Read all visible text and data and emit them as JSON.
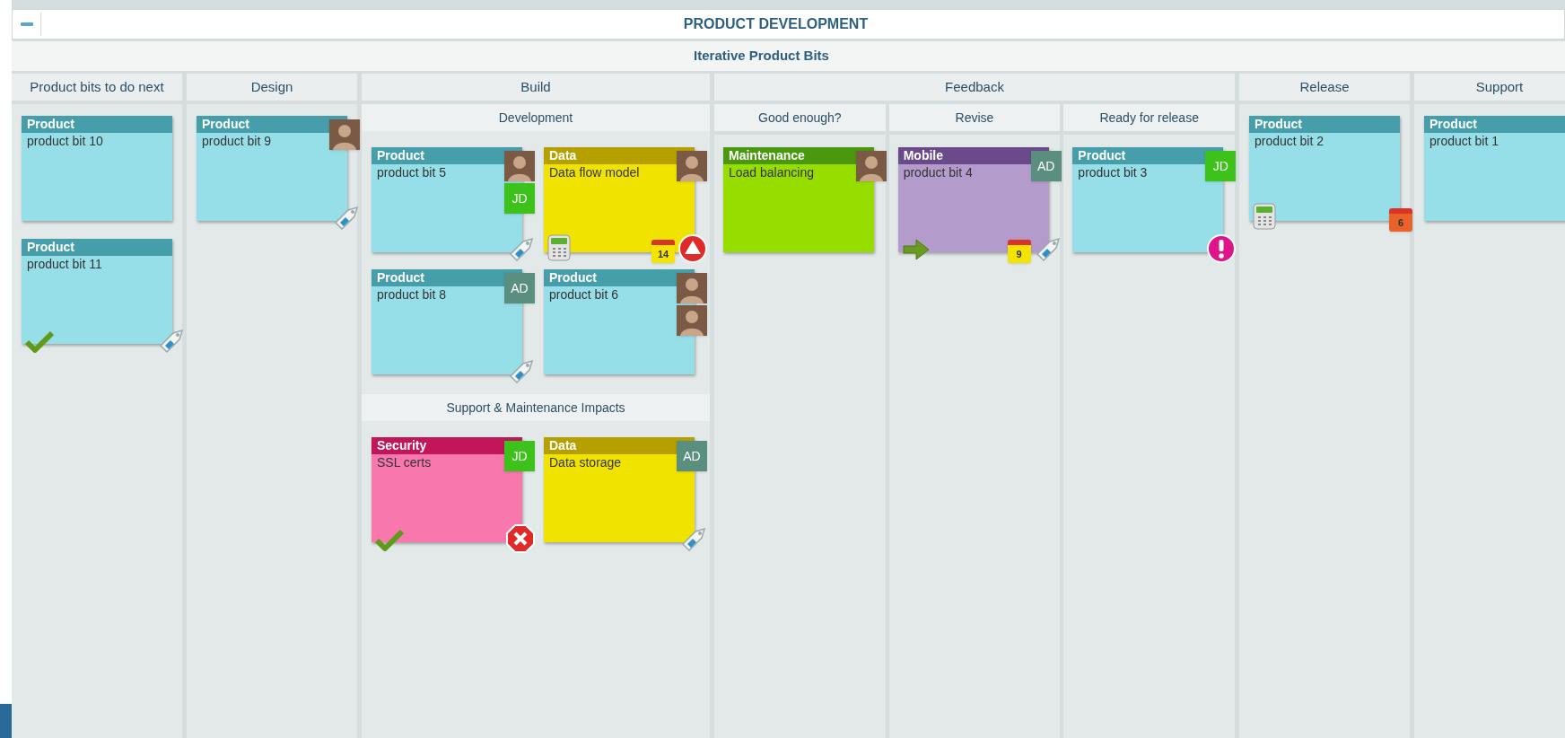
{
  "board": {
    "title": "PRODUCT DEVELOPMENT",
    "subtitle": "Iterative Product Bits"
  },
  "columns": [
    {
      "title": "Product bits to do next",
      "cards": [
        {
          "kind": "product",
          "category": "Product",
          "title": "product bit 10"
        },
        {
          "kind": "product",
          "category": "Product",
          "title": "product bit 11",
          "left_icons": [
            {
              "kind": "check"
            }
          ],
          "right_icons": [
            {
              "kind": "tag"
            }
          ]
        }
      ]
    },
    {
      "title": "Design",
      "cards": [
        {
          "kind": "product",
          "category": "Product",
          "title": "product bit 9",
          "avatars": [
            {
              "kind": "photo"
            }
          ],
          "right_icons": [
            {
              "kind": "tag"
            }
          ]
        }
      ]
    },
    {
      "title": "Build",
      "sections": [
        {
          "title": "Development",
          "cards": [
            {
              "kind": "product",
              "category": "Product",
              "title": "product bit 5",
              "avatars": [
                {
                  "kind": "photo"
                },
                {
                  "kind": "initials",
                  "text": "JD",
                  "color": "#3cc21a"
                }
              ],
              "right_icons": [
                {
                  "kind": "tag"
                }
              ]
            },
            {
              "kind": "data",
              "category": "Data",
              "title": "Data flow model",
              "avatars": [
                {
                  "kind": "photo"
                }
              ],
              "left_icons": [
                {
                  "kind": "calculator"
                }
              ],
              "right_icons": [
                {
                  "kind": "calendar",
                  "text": "14",
                  "color": "#f5e400"
                },
                {
                  "kind": "alert"
                }
              ]
            },
            {
              "kind": "product",
              "category": "Product",
              "title": "product bit 8",
              "avatars": [
                {
                  "kind": "initials",
                  "text": "AD",
                  "color": "#5a8f80"
                }
              ],
              "right_icons": [
                {
                  "kind": "tag"
                }
              ]
            },
            {
              "kind": "product",
              "category": "Product",
              "title": "product bit 6",
              "avatars": [
                {
                  "kind": "photo"
                },
                {
                  "kind": "photo"
                }
              ]
            }
          ]
        },
        {
          "title": "Support & Maintenance Impacts",
          "cards": [
            {
              "kind": "security",
              "category": "Security",
              "title": "SSL certs",
              "avatars": [
                {
                  "kind": "initials",
                  "text": "JD",
                  "color": "#3cc21a"
                }
              ],
              "left_icons": [
                {
                  "kind": "check"
                }
              ],
              "right_icons": [
                {
                  "kind": "error"
                }
              ]
            },
            {
              "kind": "data",
              "category": "Data",
              "title": "Data storage",
              "avatars": [
                {
                  "kind": "initials",
                  "text": "AD",
                  "color": "#5a8f80"
                }
              ],
              "right_icons": [
                {
                  "kind": "tag"
                }
              ]
            }
          ]
        }
      ]
    },
    {
      "title": "Feedback",
      "subcolumns": [
        {
          "title": "Good enough?",
          "cards": [
            {
              "kind": "maintenance",
              "category": "Maintenance",
              "title": "Load balancing",
              "avatars": [
                {
                  "kind": "photo"
                }
              ]
            }
          ]
        },
        {
          "title": "Revise",
          "cards": [
            {
              "kind": "mobile",
              "category": "Mobile",
              "title": "product bit 4",
              "avatars": [
                {
                  "kind": "initials",
                  "text": "AD",
                  "color": "#5a8f80"
                }
              ],
              "left_icons": [
                {
                  "kind": "arrow"
                }
              ],
              "right_icons": [
                {
                  "kind": "calendar",
                  "text": "9",
                  "color": "#f5e400"
                },
                {
                  "kind": "tag"
                }
              ]
            }
          ]
        },
        {
          "title": "Ready for release",
          "cards": [
            {
              "kind": "product",
              "category": "Product",
              "title": "product bit 3",
              "avatars": [
                {
                  "kind": "initials",
                  "text": "JD",
                  "color": "#3cc21a"
                }
              ],
              "right_icons": [
                {
                  "kind": "exclamation"
                }
              ]
            }
          ]
        }
      ]
    },
    {
      "title": "Release",
      "cards": [
        {
          "kind": "product",
          "category": "Product",
          "title": "product bit 2",
          "left_icons": [
            {
              "kind": "calculator"
            }
          ],
          "right_icons": [
            {
              "kind": "calendar",
              "text": "6",
              "color": "#e8622a"
            }
          ]
        }
      ]
    },
    {
      "title": "Support",
      "cards": [
        {
          "kind": "product",
          "category": "Product",
          "title": "product bit 1"
        }
      ]
    }
  ]
}
